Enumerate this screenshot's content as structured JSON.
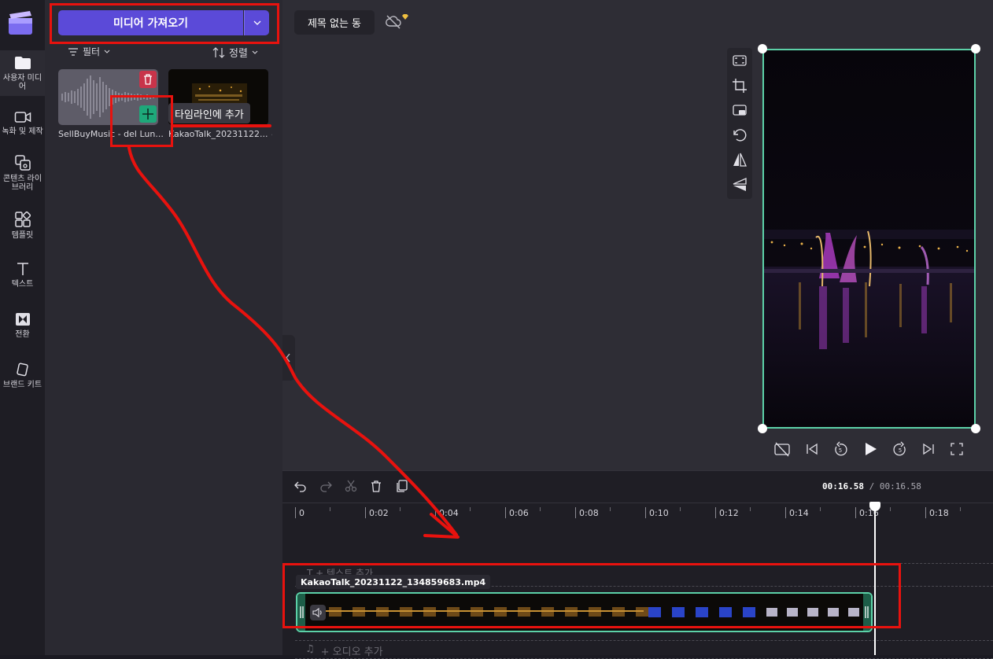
{
  "panel": {
    "import_label": "미디어 가져오기",
    "filter_label": "필터",
    "sort_label": "정렬",
    "tooltip_label": "타임라인에 추가"
  },
  "media": [
    {
      "label": "SellBuyMusic - del Lun...",
      "type": "audio"
    },
    {
      "label": "KakaoTalk_20231122...",
      "type": "video"
    }
  ],
  "rail": {
    "items": [
      {
        "label": "사용자 미디어",
        "icon": "folder-icon"
      },
      {
        "label": "녹화 및 제작",
        "icon": "camera-icon"
      },
      {
        "label": "콘텐츠 라이브러리",
        "icon": "library-icon"
      },
      {
        "label": "템플릿",
        "icon": "template-icon"
      },
      {
        "label": "텍스트",
        "icon": "text-icon"
      },
      {
        "label": "전환",
        "icon": "transition-icon"
      },
      {
        "label": "브랜드 키트",
        "icon": "brand-kit-icon"
      }
    ]
  },
  "header": {
    "project_title": "제목 없는 동"
  },
  "timeline": {
    "current_time": "00:16.58",
    "separator": " / ",
    "total_time": "00:16.58",
    "ticks": [
      "0",
      "0:02",
      "0:04",
      "0:06",
      "0:08",
      "0:10",
      "0:12",
      "0:14",
      "0:16",
      "0:18"
    ],
    "text_track_label": "T  + 텍스트 추가",
    "clip_name": "KakaoTalk_20231122_134859683.mp4",
    "audio_track_label": "+ 오디오 추가"
  },
  "colors": {
    "accent": "#5b4ad8",
    "clip_border": "#5cd1a8",
    "annotation_red": "#e8120e"
  }
}
